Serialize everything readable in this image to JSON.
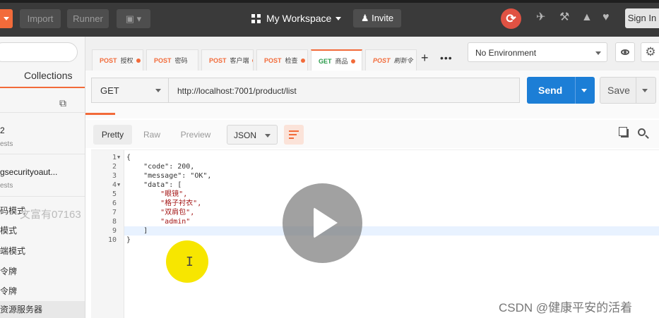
{
  "toolbar": {
    "import_label": "Import",
    "runner_label": "Runner",
    "workspace_label": "My Workspace",
    "invite_label": "Invite",
    "signin_label": "Sign In"
  },
  "sidebar": {
    "collections_tab": "Collections",
    "collections": [
      {
        "name": "2",
        "sub": "ests"
      },
      {
        "name": "gsecurityoaut...",
        "sub": "ests"
      }
    ],
    "items": [
      {
        "label": "码模式"
      },
      {
        "label": "模式"
      },
      {
        "label": "端模式"
      },
      {
        "label": "令牌"
      },
      {
        "label": "令牌"
      },
      {
        "label": "资源服务器"
      }
    ]
  },
  "tabs": [
    {
      "method": "POST",
      "label": "授权",
      "dirty": true
    },
    {
      "method": "POST",
      "label": "密码",
      "dirty": false
    },
    {
      "method": "POST",
      "label": "客户端",
      "dirty": true
    },
    {
      "method": "POST",
      "label": "检查",
      "dirty": true
    },
    {
      "method": "GET",
      "label": "商品",
      "dirty": true,
      "active": true
    },
    {
      "method": "POST",
      "label": "刷新令",
      "dirty": false
    }
  ],
  "environment": {
    "selected": "No Environment"
  },
  "request": {
    "method": "GET",
    "url": "http://localhost:7001/product/list",
    "send_label": "Send",
    "save_label": "Save"
  },
  "response": {
    "modes": [
      "Pretty",
      "Raw",
      "Preview"
    ],
    "active_mode": "Pretty",
    "format": "JSON",
    "code_lines": [
      "{",
      "    \"code\": 200,",
      "    \"message\": \"OK\",",
      "    \"data\": [",
      "        \"眼镜\",",
      "        \"格子衬衣\",",
      "        \"双肩包\",",
      "        \"admin\"",
      "    ]",
      "}"
    ],
    "line_numbers": [
      "1",
      "2",
      "3",
      "4",
      "5",
      "6",
      "7",
      "8",
      "9",
      "10"
    ],
    "code": 200,
    "message": "OK",
    "data": [
      "眼镜",
      "格子衬衣",
      "双肩包",
      "admin"
    ]
  },
  "overlay": {
    "watermark_text": "文富有07163",
    "csdn_text": "CSDN @健康平安的活着"
  },
  "colors": {
    "accent": "#f26b3a",
    "send_blue": "#1c7ed6",
    "sync_red": "#e05243"
  }
}
